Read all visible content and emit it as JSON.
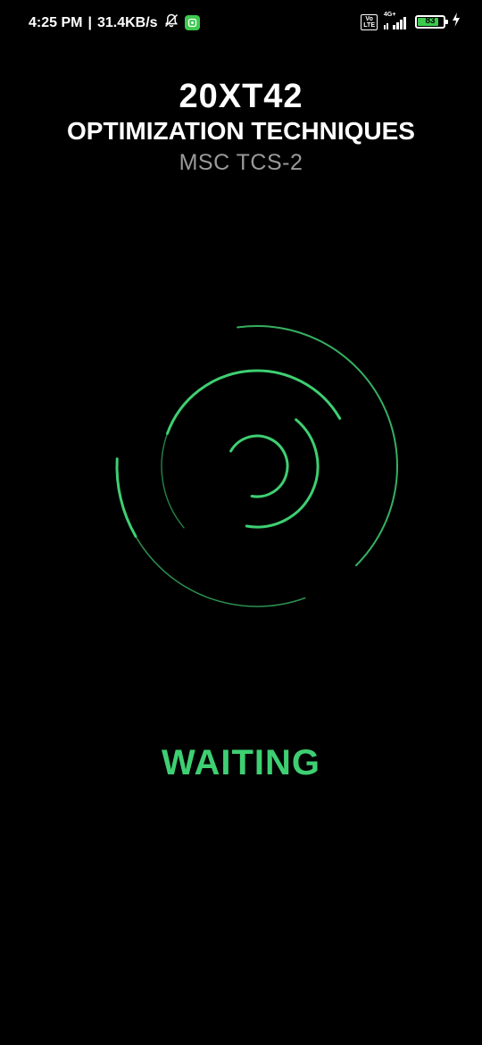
{
  "status_bar": {
    "time": "4:25 PM",
    "separator": "|",
    "net_speed": "31.4KB/s",
    "volte_top": "Vo",
    "volte_bottom": "LTE",
    "network_type": "4G+",
    "battery_level": "83",
    "battery_fraction": 0.83,
    "icons": [
      "bell-off-icon",
      "app-notification-icon",
      "volte-icon",
      "signal-icon",
      "battery-icon",
      "charging-icon"
    ]
  },
  "header": {
    "course_code": "20XT42",
    "course_name": "OPTIMIZATION TECHNIQUES",
    "class_name": "MSC TCS-2"
  },
  "spinner": {
    "accent_color": "#3ecf72",
    "icon": "loading-spinner-icon"
  },
  "status": {
    "label": "WAITING",
    "color": "#3ecf72"
  }
}
